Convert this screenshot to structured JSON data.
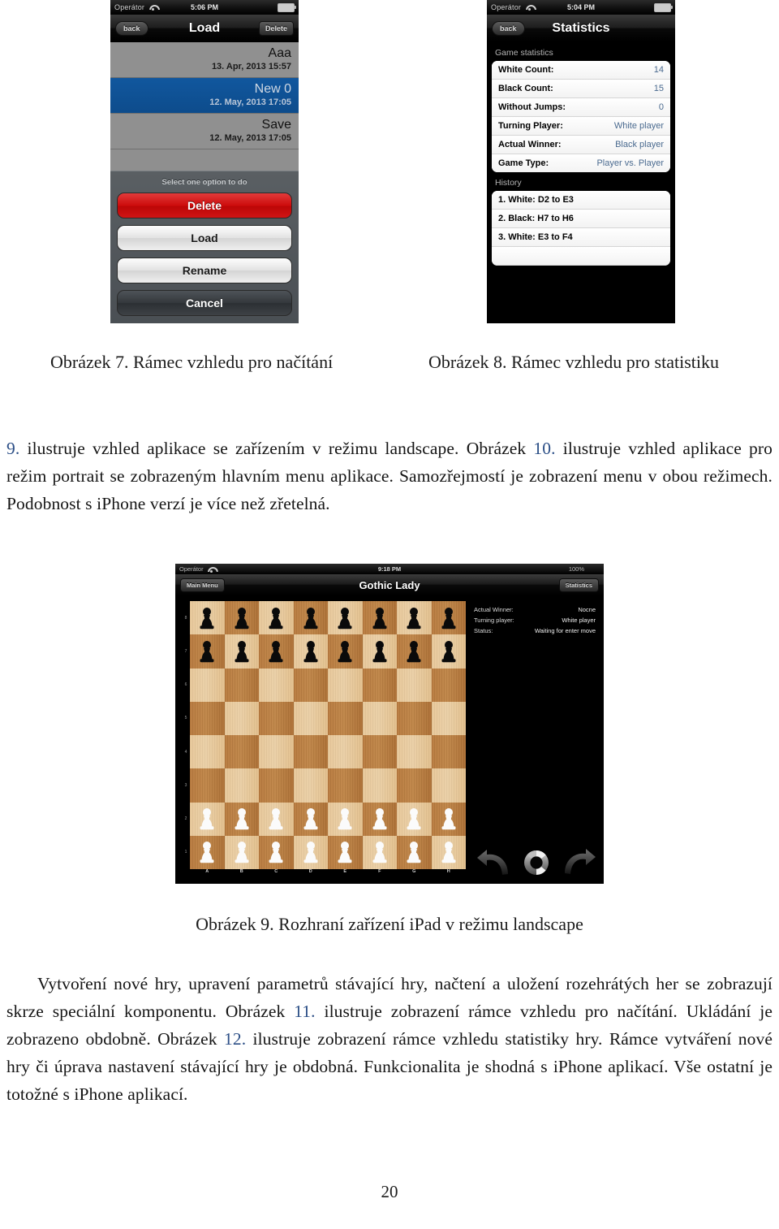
{
  "document": {
    "page_number": "20",
    "language": "cs"
  },
  "figure7": {
    "caption": "Obrázek 7. Rámec vzhledu pro načítání",
    "screen": {
      "status_bar": {
        "carrier": "Operátor",
        "wifi_icon": "wifi-icon",
        "time": "5:06 PM",
        "battery_icon": "battery-icon"
      },
      "nav": {
        "back_label": "back",
        "title": "Load",
        "right_label": "Delete"
      },
      "rows": [
        {
          "name": "Aaa",
          "date": "13. Apr, 2013 15:57",
          "selected": false
        },
        {
          "name": "New 0",
          "date": "12. May, 2013 17:05",
          "selected": true
        },
        {
          "name": "Save",
          "date": "12. May, 2013 17:05",
          "selected": false
        }
      ],
      "action_sheet": {
        "title": "Select one option to do",
        "buttons": [
          {
            "label": "Delete",
            "style": "destructive"
          },
          {
            "label": "Load",
            "style": "normal"
          },
          {
            "label": "Rename",
            "style": "normal"
          },
          {
            "label": "Cancel",
            "style": "cancel"
          }
        ]
      }
    }
  },
  "figure8": {
    "caption": "Obrázek 8. Rámec vzhledu pro statistiku",
    "screen": {
      "status_bar": {
        "carrier": "Operátor",
        "wifi_icon": "wifi-icon",
        "time": "5:04 PM",
        "battery_icon": "battery-icon"
      },
      "nav": {
        "back_label": "back",
        "title": "Statistics"
      },
      "section_stats_title": "Game statistics",
      "stats": [
        {
          "key": "White Count:",
          "value": "14"
        },
        {
          "key": "Black Count:",
          "value": "15"
        },
        {
          "key": "Without Jumps:",
          "value": "0"
        },
        {
          "key": "Turning Player:",
          "value": "White player"
        },
        {
          "key": "Actual Winner:",
          "value": "Black player"
        },
        {
          "key": "Game Type:",
          "value": "Player vs. Player"
        }
      ],
      "section_history_title": "History",
      "history": [
        "1. White: D2 to E3",
        "2. Black: H7 to H6",
        "3. White: E3 to F4"
      ]
    }
  },
  "figure9": {
    "caption": "Obrázek 9. Rozhraní zařízení iPad v režimu landscape",
    "screen": {
      "status_bar": {
        "carrier": "Operátor",
        "wifi_icon": "wifi-icon",
        "time": "9:18 PM",
        "battery_percent": "100%",
        "battery_icon": "battery-icon"
      },
      "nav": {
        "left_label": "Main Menu",
        "title": "Gothic Lady",
        "right_label": "Statistics"
      },
      "info": [
        {
          "key": "Actual Winner:",
          "value": "Nocne"
        },
        {
          "key": "Turning player:",
          "value": "White player"
        },
        {
          "key": "Status:",
          "value": "Waiting for enter move"
        }
      ],
      "board": {
        "rank_labels": [
          "8",
          "7",
          "6",
          "5",
          "4",
          "3",
          "2",
          "1"
        ],
        "file_labels": [
          "A",
          "B",
          "C",
          "D",
          "E",
          "F",
          "G",
          "H"
        ],
        "light_square_color": "#e8cba0",
        "dark_square_color": "#b97c3f",
        "black_piece_color": "#0a0a0a",
        "white_piece_color": "#fbfbfb",
        "pieces": {
          "black_pawn_ranks": [
            "8",
            "7"
          ],
          "white_pawn_ranks": [
            "2",
            "1"
          ]
        }
      },
      "controls": [
        {
          "icon": "undo-arrow-icon"
        },
        {
          "icon": "lifebuoy-icon"
        },
        {
          "icon": "redo-arrow-icon"
        }
      ]
    }
  },
  "body": {
    "paragraph1_parts": [
      {
        "text": "9.",
        "ref": true
      },
      {
        "text": " ilustruje vzhled aplikace se zařízením v režimu landscape. Obrázek ",
        "ref": false
      },
      {
        "text": "10.",
        "ref": true
      },
      {
        "text": " ilustruje vzhled aplikace pro režim portrait se zobrazeným hlavním menu aplikace. Samozřejmostí je zobrazení menu v obou režimech. Podobnost s iPhone verzí je více než zřetelná.",
        "ref": false
      }
    ],
    "paragraph2_parts": [
      {
        "text": "Vytvoření nové hry, upravení parametrů stávající hry, načtení a uložení rozehrátých her se zobrazují skrze speciální komponentu. Obrázek ",
        "ref": false
      },
      {
        "text": "11.",
        "ref": true
      },
      {
        "text": " ilustruje zobrazení rámce vzhledu pro načítání. Ukládání je zobrazeno obdobně. Obrázek ",
        "ref": false
      },
      {
        "text": "12.",
        "ref": true
      },
      {
        "text": " ilustruje zobrazení rámce vzhledu statistiky hry. Rámce vytváření nové hry či úprava nastavení stávající hry je obdobná. Funkcionalita je shodná s iPhone aplikací. Vše ostatní je totožné s iPhone aplikací.",
        "ref": false
      }
    ]
  }
}
